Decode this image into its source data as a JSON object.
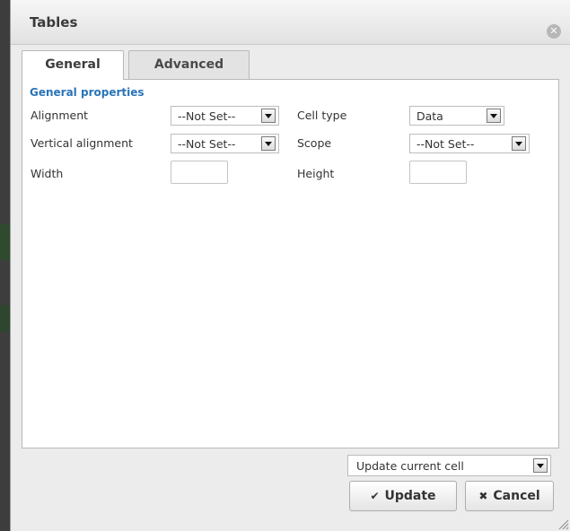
{
  "dialog": {
    "title": "Tables",
    "close_icon": "close-icon"
  },
  "tabs": [
    {
      "label": "General",
      "active": true
    },
    {
      "label": "Advanced",
      "active": false
    }
  ],
  "general": {
    "section_title": "General properties",
    "alignment": {
      "label": "Alignment",
      "value": "--Not Set--"
    },
    "vertical_alignment": {
      "label": "Vertical alignment",
      "value": "--Not Set--"
    },
    "width": {
      "label": "Width",
      "value": ""
    },
    "cell_type": {
      "label": "Cell type",
      "value": "Data"
    },
    "scope": {
      "label": "Scope",
      "value": "--Not Set--"
    },
    "height": {
      "label": "Height",
      "value": ""
    }
  },
  "footer": {
    "action_select": "Update current cell",
    "update_label": "Update",
    "cancel_label": "Cancel",
    "update_icon": "checkmark-icon",
    "cancel_icon": "x-icon"
  },
  "colors": {
    "section_title": "#2a74b8",
    "dialog_bg": "#ececec"
  }
}
